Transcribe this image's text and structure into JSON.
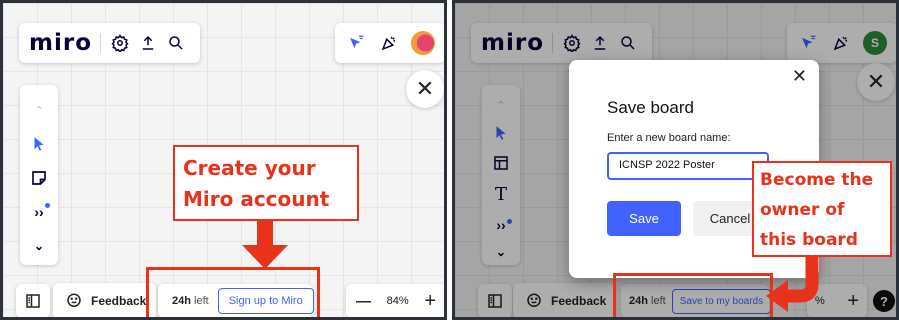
{
  "left": {
    "brand": "miro",
    "annotation": {
      "line1": "Create your",
      "line2": "Miro account"
    },
    "timer": {
      "value": "24h",
      "suffix": "left"
    },
    "signup_button": "Sign up to Miro",
    "feedback_label": "Feedback",
    "zoom": {
      "minus": "—",
      "value": "84%",
      "plus": "+"
    }
  },
  "right": {
    "brand": "miro",
    "modal": {
      "title": "Save board",
      "field_label": "Enter a new board name:",
      "field_value": "ICNSP 2022 Poster",
      "save_label": "Save",
      "cancel_label": "Cancel"
    },
    "annotation": {
      "line1": "Become the",
      "line2": "owner of",
      "line3": "this board"
    },
    "timer": {
      "value": "24h",
      "suffix": "left"
    },
    "save_boards_button": "Save to my boards",
    "feedback_label": "Feedback",
    "zoom": {
      "value_partial": "%",
      "plus": "+"
    },
    "help": "?",
    "avatar_letter": "S"
  },
  "colors": {
    "accent": "#4262ff",
    "annotation_red": "#e8321a",
    "brand": "#050038",
    "avatar_left": "#f29b3b",
    "avatar_right": "#2e8b3e"
  },
  "icons": [
    "settings-icon",
    "upload-icon",
    "search-icon",
    "reactions-icon",
    "celebrate-icon",
    "close-icon",
    "collapse-up-icon",
    "cursor-icon",
    "sticky-note-icon",
    "more-icon",
    "chevron-down-icon",
    "frame-icon",
    "text-icon",
    "sidebar-icon",
    "feedback-icon",
    "help-icon"
  ]
}
